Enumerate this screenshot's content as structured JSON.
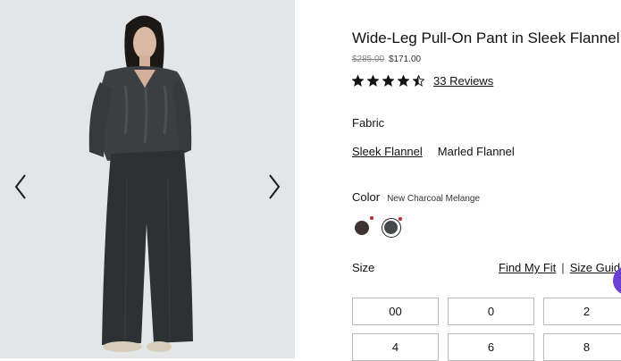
{
  "gallery": {
    "prev_icon": "chevron-left-icon",
    "next_icon": "chevron-right-icon",
    "photo_colors": {
      "background": "#e4e5e7",
      "sweater": "#3b3f42",
      "pants": "#2e3133",
      "skin": "#d9b9a1",
      "hair": "#1c1816",
      "shoes": "#d8cdb8"
    }
  },
  "product": {
    "title": "Wide-Leg Pull-On Pant in Sleek Flannel",
    "original_price": "$285.00",
    "sale_price": "$171.00",
    "rating": 4.5,
    "reviews_label": "33 Reviews"
  },
  "fabric": {
    "label": "Fabric",
    "options": [
      "Sleek Flannel",
      "Marled Flannel"
    ],
    "selected": "Sleek Flannel"
  },
  "color": {
    "label": "Color",
    "selected_name": "New Charcoal Melange",
    "swatches": [
      {
        "color": "#3d3335"
      },
      {
        "color": "#45494c"
      }
    ],
    "indicator_color": "#c0272d"
  },
  "size": {
    "label": "Size",
    "find_fit": "Find My Fit",
    "separator": "|",
    "size_guide": "Size Guide",
    "options": [
      "00",
      "0",
      "2",
      "4",
      "6",
      "8"
    ]
  },
  "chat": {
    "icon": "chat-icon",
    "color": "#6a3fd2"
  }
}
